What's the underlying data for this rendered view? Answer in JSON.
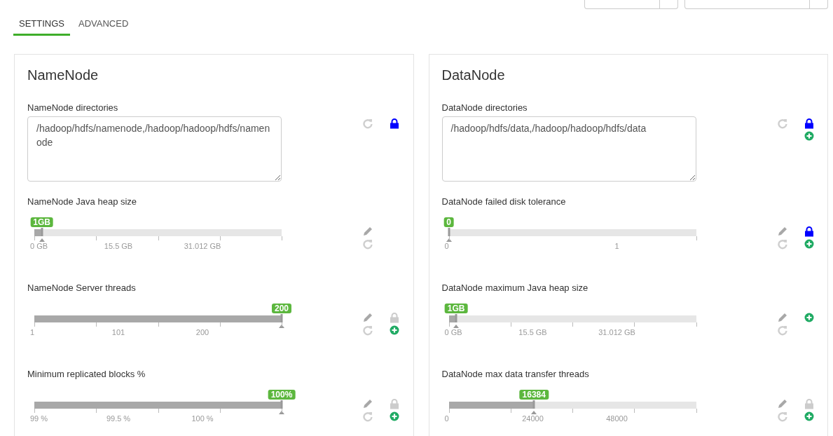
{
  "toolbar": {
    "buttons": [
      {
        "kind": "split"
      },
      {
        "kind": "filter"
      }
    ]
  },
  "tabs": [
    {
      "label": "SETTINGS",
      "selected": true
    },
    {
      "label": "ADVANCED",
      "selected": false
    }
  ],
  "panels": [
    {
      "title": "NameNode",
      "configs": [
        {
          "kind": "text",
          "label": "NameNode directories",
          "value": "/hadoop/hdfs/namenode,/hadoop/hadoop/hdfs/namenode",
          "locked": true
        },
        {
          "kind": "slider",
          "label": "NameNode Java heap size",
          "reading": "1GB",
          "level": 0.03,
          "ticks": [
            "0 GB",
            "15.5 GB",
            "31.012 GB"
          ]
        },
        {
          "kind": "slider",
          "label": "NameNode Server threads",
          "reading": "200",
          "level": 1,
          "ticks": [
            "1",
            "101",
            "200"
          ],
          "locked": false,
          "add": true
        },
        {
          "kind": "slider",
          "label": "Minimum replicated blocks %",
          "reading": "100%",
          "level": 1,
          "ticks": [
            "99 %",
            "99.5 %",
            "100 %"
          ],
          "locked": false,
          "add": true
        }
      ]
    },
    {
      "title": "DataNode",
      "configs": [
        {
          "kind": "text",
          "label": "DataNode directories",
          "value": "/hadoop/hdfs/data,/hadoop/hadoop/hdfs/data",
          "locked": true,
          "add": true
        },
        {
          "kind": "slider",
          "label": "DataNode failed disk tolerance",
          "reading": "0",
          "level": 0,
          "ticks": [
            "0",
            "1"
          ],
          "locked": true,
          "add": true
        },
        {
          "kind": "slider",
          "label": "DataNode maximum Java heap size",
          "reading": "1GB",
          "level": 0.03,
          "ticks": [
            "0 GB",
            "15.5 GB",
            "31.012 GB"
          ],
          "add": true
        },
        {
          "kind": "slider",
          "label": "DataNode max data transfer threads",
          "reading": "16384",
          "level": 0.345,
          "ticks": [
            "0",
            "24000",
            "48000"
          ],
          "locked": false,
          "add": true
        }
      ]
    }
  ]
}
